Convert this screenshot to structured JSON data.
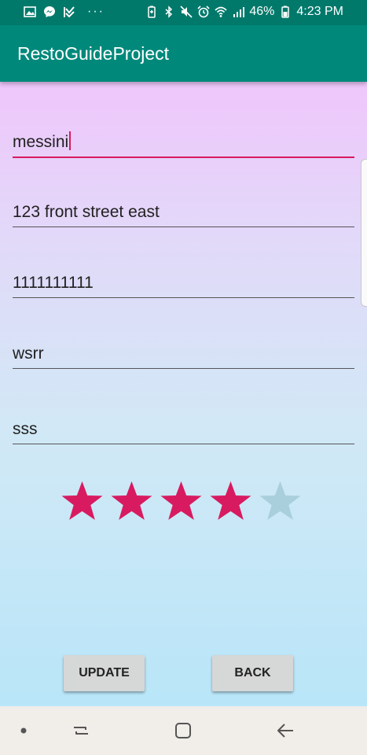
{
  "status_bar": {
    "battery": "46%",
    "time": "4:23 PM",
    "more": "···"
  },
  "app_bar": {
    "title": "RestoGuideProject"
  },
  "form": {
    "name": "messini",
    "address": "123 front street east",
    "phone": "1111111111",
    "field4": "wsrr",
    "field5": "sss"
  },
  "rating": {
    "value": 4,
    "max": 5,
    "filled_color": "#d81b60",
    "empty_color": "#a9cfdc"
  },
  "buttons": {
    "update": "UPDATE",
    "back": "BACK"
  },
  "colors": {
    "primary": "#00897b",
    "primary_dark": "#00796b",
    "accent": "#d81b60"
  }
}
